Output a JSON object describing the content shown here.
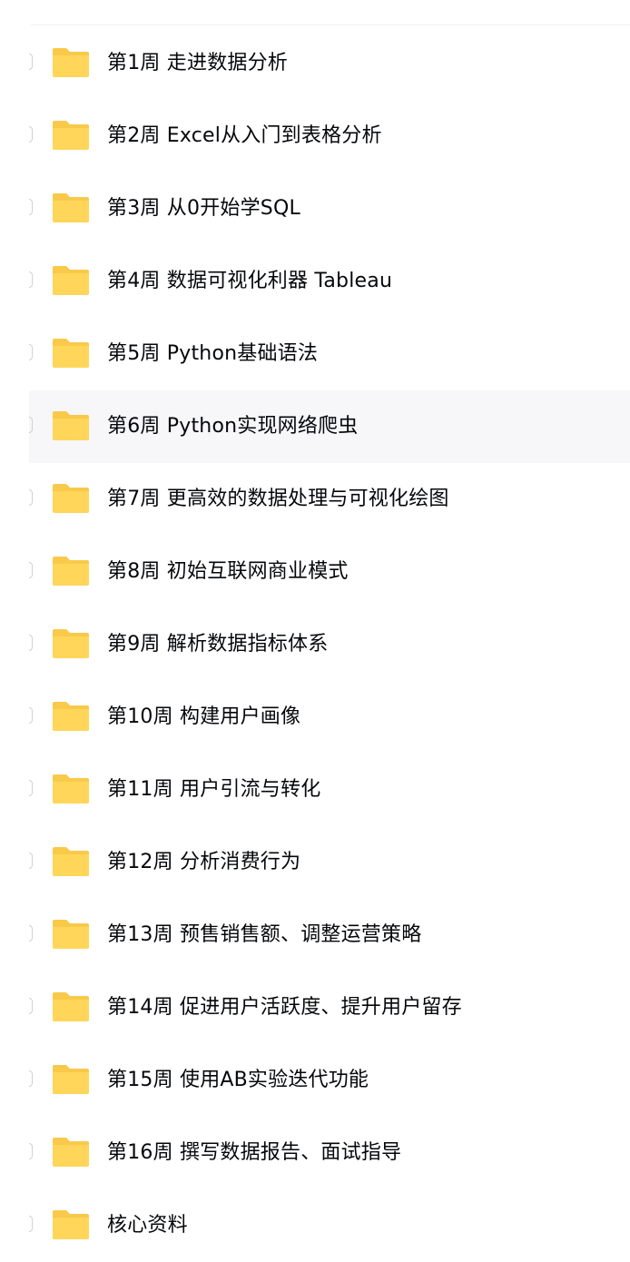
{
  "file_list": {
    "items": [
      {
        "name": "第1周 走进数据分析",
        "icon": "folder-icon"
      },
      {
        "name": "第2周 Excel从入门到表格分析",
        "icon": "folder-icon"
      },
      {
        "name": "第3周 从0开始学SQL",
        "icon": "folder-icon"
      },
      {
        "name": "第4周 数据可视化利器 Tableau",
        "icon": "folder-icon"
      },
      {
        "name": "第5周 Python基础语法",
        "icon": "folder-icon"
      },
      {
        "name": "第6周 Python实现网络爬虫",
        "icon": "folder-icon",
        "hovered": true
      },
      {
        "name": "第7周 更高效的数据处理与可视化绘图",
        "icon": "folder-icon"
      },
      {
        "name": "第8周 初始互联网商业模式",
        "icon": "folder-icon"
      },
      {
        "name": "第9周 解析数据指标体系",
        "icon": "folder-icon"
      },
      {
        "name": "第10周 构建用户画像",
        "icon": "folder-icon"
      },
      {
        "name": "第11周 用户引流与转化",
        "icon": "folder-icon"
      },
      {
        "name": "第12周 分析消费行为",
        "icon": "folder-icon"
      },
      {
        "name": "第13周 预售销售额、调整运营策略",
        "icon": "folder-icon"
      },
      {
        "name": "第14周 促进用户活跃度、提升用户留存",
        "icon": "folder-icon"
      },
      {
        "name": "第15周 使用AB实验迭代功能",
        "icon": "folder-icon"
      },
      {
        "name": "第16周 撰写数据报告、面试指导",
        "icon": "folder-icon"
      },
      {
        "name": "核心资料",
        "icon": "folder-icon"
      }
    ]
  },
  "colors": {
    "folder": "#ffd65a",
    "folder_back": "#f9c94a",
    "hover_background": "#f7f7f9",
    "text": "#05070a"
  }
}
